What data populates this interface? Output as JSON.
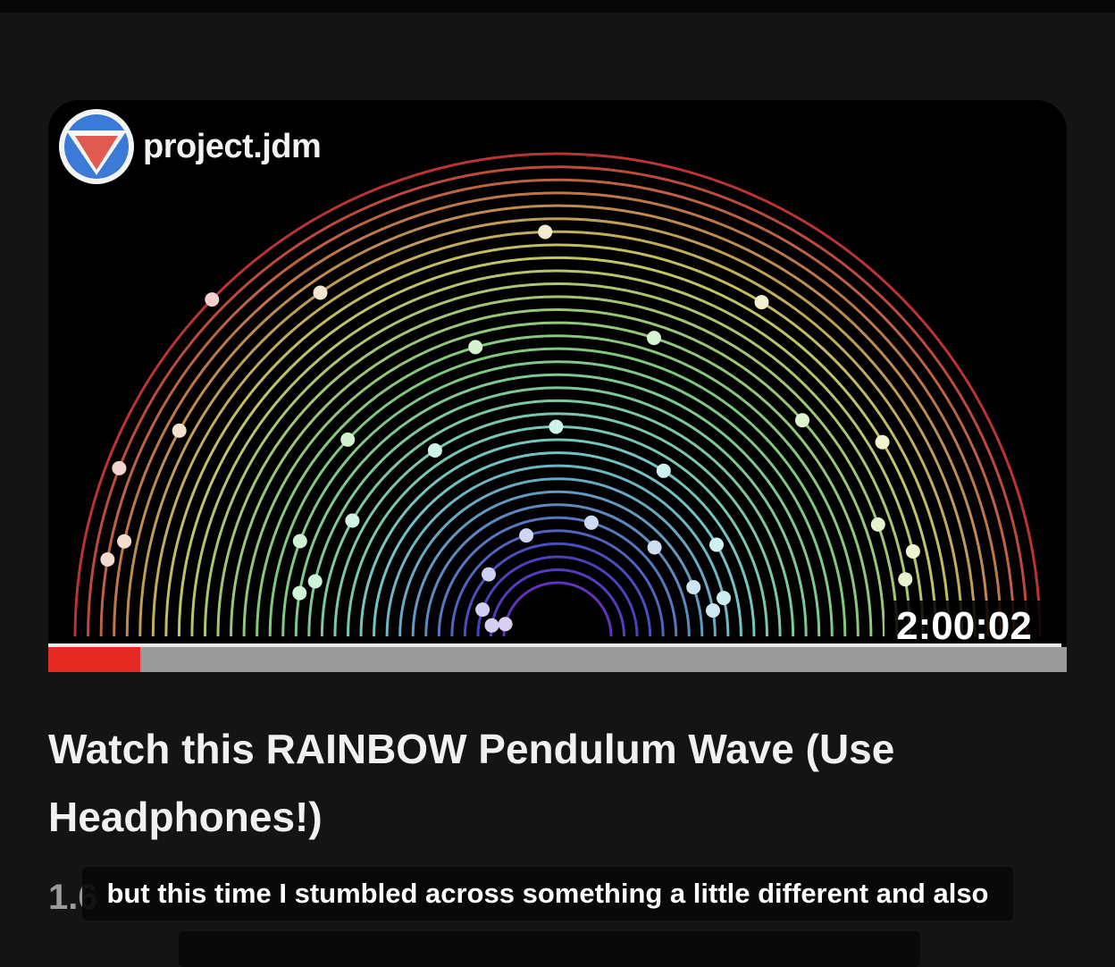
{
  "video": {
    "channel_name": "project.jdm",
    "channel_logo_icon": "inverted-triangle-logo-icon",
    "duration": "2:00:02",
    "watched_fraction": 0.09,
    "title": "Watch this RAINBOW Pendulum Wave (Use Headphones!)",
    "views_partial": "1.6"
  },
  "captions": {
    "line1": "but this time I stumbled across something a little different and also"
  },
  "colors": {
    "progress": "#e52a24",
    "background": "#141414"
  }
}
